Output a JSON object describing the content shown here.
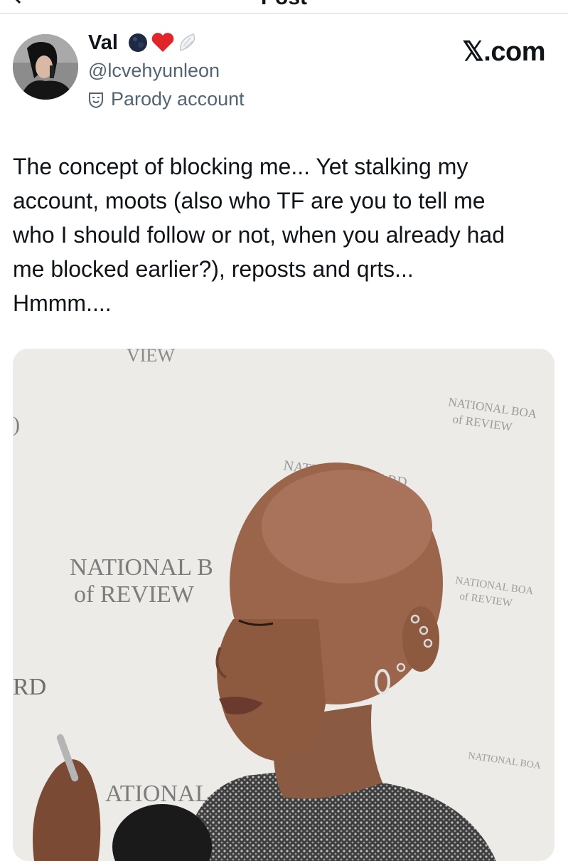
{
  "header": {
    "title": "Post"
  },
  "author": {
    "name": "Val",
    "handle": "@lcvehyunleon",
    "label": "Parody account",
    "badge_icons": [
      "moon-emoji",
      "red-heart-emoji",
      "wing-emoji"
    ]
  },
  "brand": {
    "text": "𝕏.com"
  },
  "post": {
    "lines": [
      "The concept of blocking me... Yet stalking my",
      "account, moots (also who TF are you to tell me",
      "who I should follow or not, when you already had",
      "me blocked earlier?), reposts and qrts...",
      "Hmmm...."
    ]
  },
  "media": {
    "backdrop_texts": {
      "top": "VIEW",
      "tr1": "NATIONAL BOA",
      "tr2": "of REVIEW",
      "mid": "NATIONAL BOARD",
      "left1": "NATIONAL B",
      "left2": "of REVIEW",
      "right1": "NATIONAL BOA",
      "right2": "of REVIEW",
      "rd": "RD",
      "d": ")",
      "bottom": "ATIONAL",
      "bottom_right": "NATIONAL BOA"
    }
  },
  "colors": {
    "text": "#0f1419",
    "secondary": "#536471",
    "backdrop": "#ecebe8"
  }
}
